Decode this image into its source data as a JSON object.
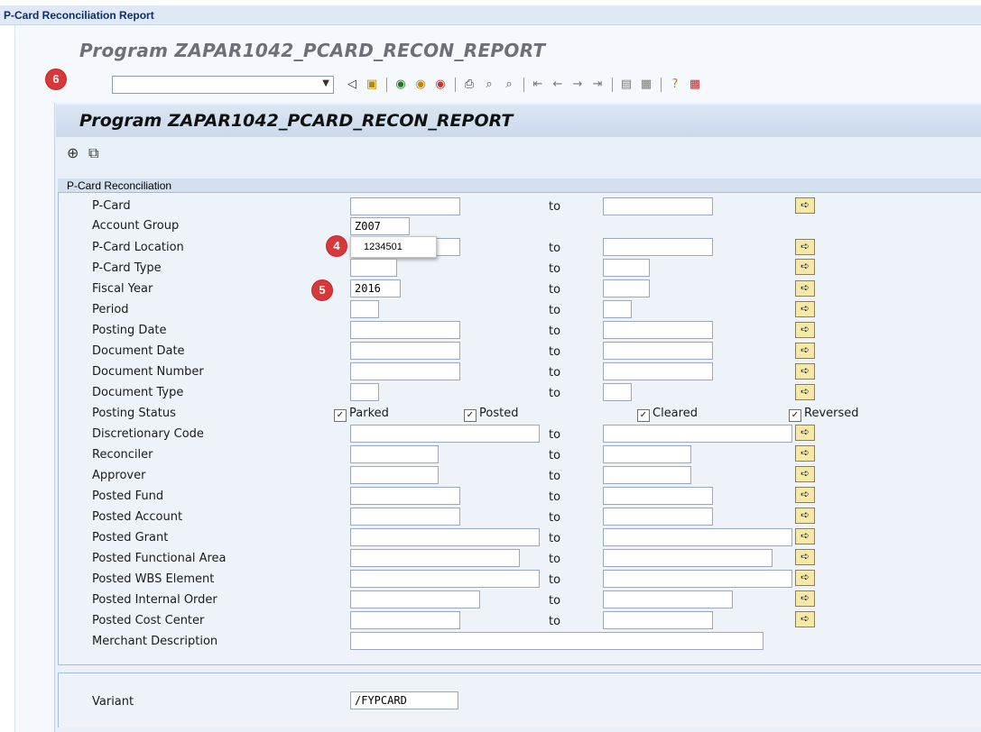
{
  "window": {
    "title": "P-Card Reconciliation Report"
  },
  "program_header": "Program ZAPAR1042_PCARD_RECON_REPORT",
  "toolbar": {
    "command_field_value": "",
    "icons": [
      "enter-icon",
      "back-icon",
      "save-icon",
      "back-arrow-icon",
      "exit-icon",
      "cancel-icon",
      "print-icon",
      "find-icon",
      "find-next-icon",
      "first-page-icon",
      "previous-page-icon",
      "next-page-icon",
      "last-page-icon",
      "create-session-icon",
      "shortcut-icon",
      "help-icon",
      "layout-menu-icon"
    ]
  },
  "inner_title": "Program ZAPAR1042_PCARD_RECON_REPORT",
  "subtoolbar": {
    "icons": [
      "execute-icon",
      "get-variant-icon"
    ]
  },
  "group": {
    "title": "P-Card Reconciliation",
    "to_label": "to",
    "rows": [
      {
        "label": "P-Card",
        "low": "",
        "high": ""
      },
      {
        "label": "Account Group",
        "low": "Z007"
      },
      {
        "label": "P-Card Location",
        "low": "",
        "high": ""
      },
      {
        "label": "P-Card Type",
        "low": "",
        "high": ""
      },
      {
        "label": "Fiscal Year",
        "low": "2016",
        "high": ""
      },
      {
        "label": "Period",
        "low": "",
        "high": ""
      },
      {
        "label": "Posting Date",
        "low": "",
        "high": ""
      },
      {
        "label": "Document Date",
        "low": "",
        "high": ""
      },
      {
        "label": "Document Number",
        "low": "",
        "high": ""
      },
      {
        "label": "Document Type",
        "low": "",
        "high": ""
      },
      {
        "label": "Posting Status"
      },
      {
        "label": "Discretionary Code",
        "low": "",
        "high": ""
      },
      {
        "label": "Reconciler",
        "low": "",
        "high": ""
      },
      {
        "label": "Approver",
        "low": "",
        "high": ""
      },
      {
        "label": "Posted Fund",
        "low": "",
        "high": ""
      },
      {
        "label": "Posted Account",
        "low": "",
        "high": ""
      },
      {
        "label": "Posted Grant",
        "low": "",
        "high": ""
      },
      {
        "label": "Posted Functional Area",
        "low": "",
        "high": ""
      },
      {
        "label": "Posted WBS Element",
        "low": "",
        "high": ""
      },
      {
        "label": "Posted Internal Order",
        "low": "",
        "high": ""
      },
      {
        "label": "Posted Cost Center",
        "low": "",
        "high": ""
      },
      {
        "label": "Merchant Description",
        "low": ""
      }
    ],
    "posting_status": [
      {
        "label": "Parked",
        "checked": true
      },
      {
        "label": "Posted",
        "checked": true
      },
      {
        "label": "Cleared",
        "checked": true
      },
      {
        "label": "Reversed",
        "checked": true
      }
    ]
  },
  "tooltip": {
    "text": "1234501"
  },
  "callouts": [
    "4",
    "5",
    "6"
  ],
  "variant": {
    "label": "Variant",
    "value": "/FYPCARD"
  },
  "colors": {
    "multi_select_button": "#f6e9a5",
    "callout_badge": "#d9383a",
    "title_bar": "#dfe9f5"
  }
}
